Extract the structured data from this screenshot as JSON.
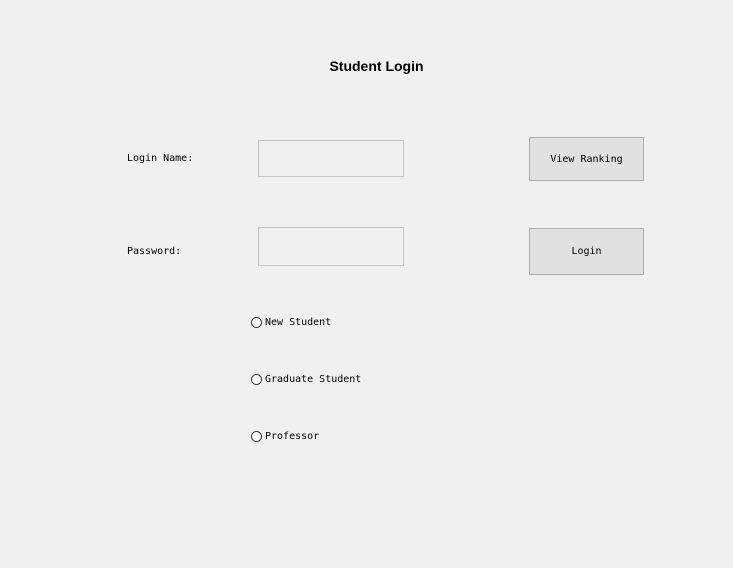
{
  "form": {
    "title": "Student Login",
    "login_name_label": "Login Name:",
    "login_name_value": "",
    "password_label": "Password:",
    "password_value": "",
    "view_ranking_label": "View Ranking",
    "login_label": "Login"
  },
  "role_options": [
    {
      "label": "New Student",
      "selected": false
    },
    {
      "label": "Graduate Student",
      "selected": false
    },
    {
      "label": "Professor",
      "selected": false
    }
  ]
}
